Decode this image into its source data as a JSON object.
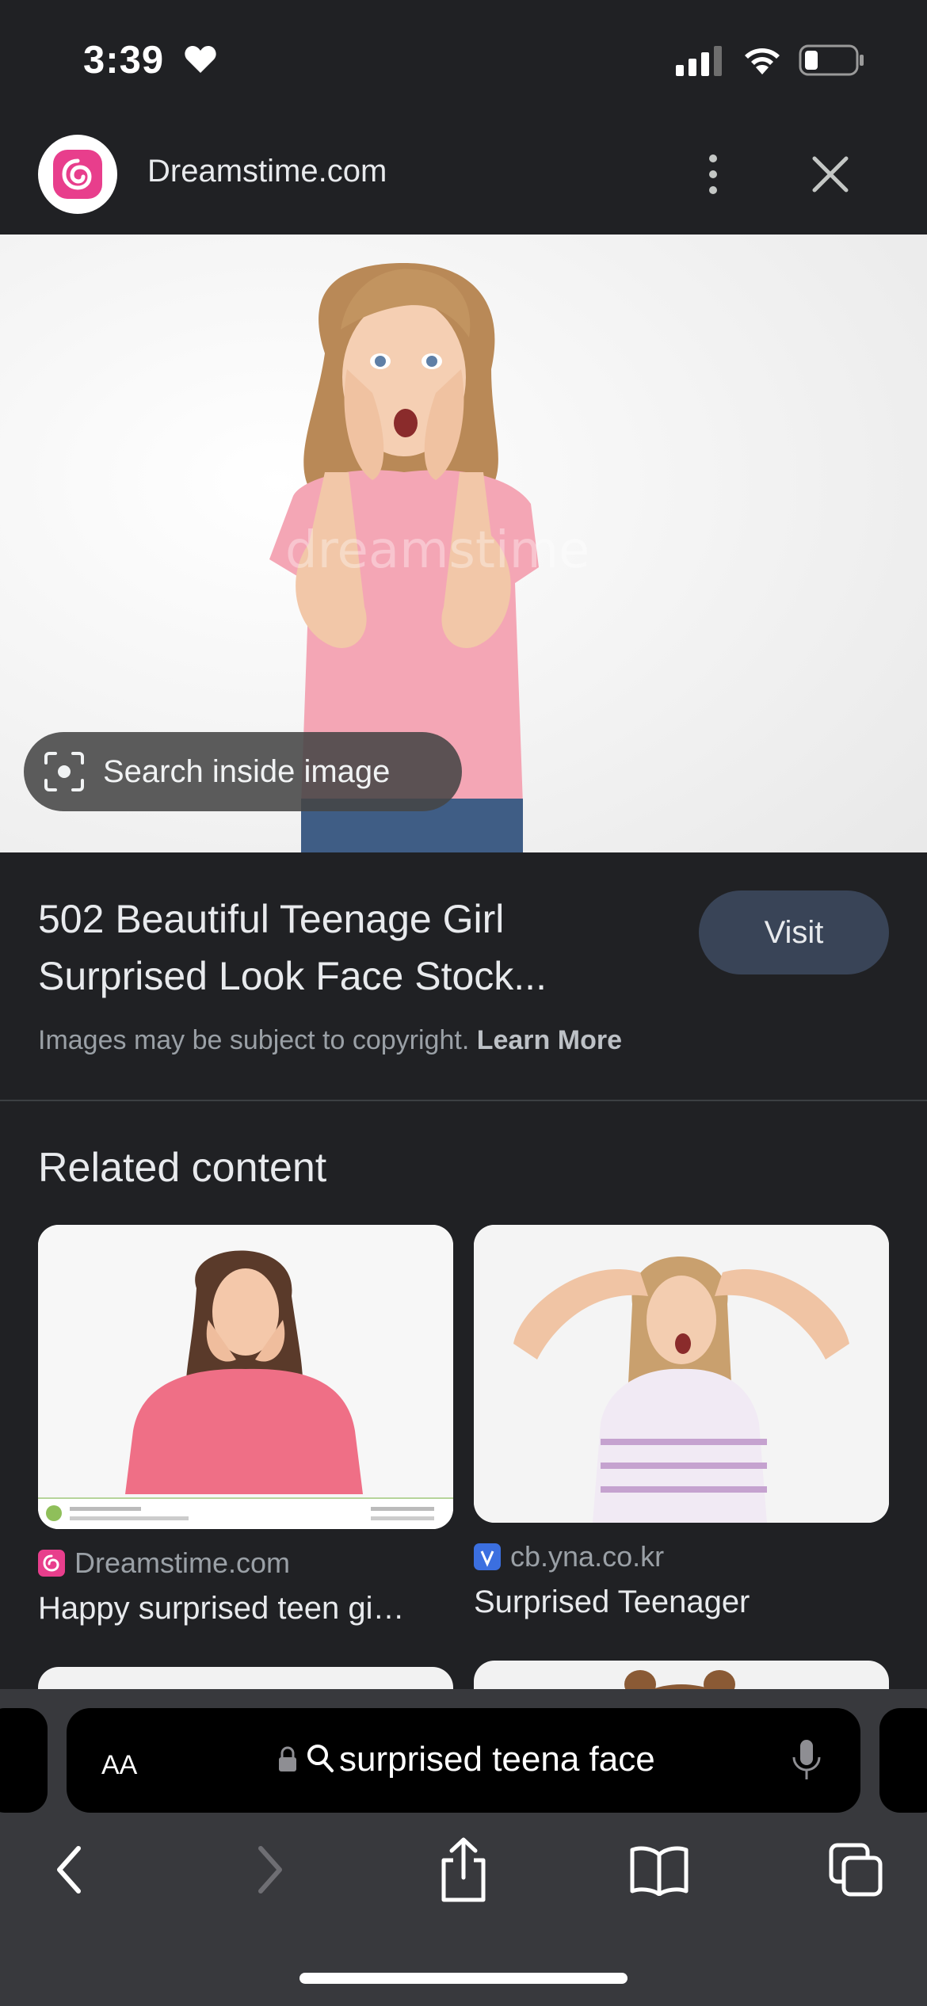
{
  "status_bar": {
    "time": "3:39"
  },
  "header": {
    "site_name": "Dreamstime.com"
  },
  "main_image": {
    "lens_label": "Search inside image"
  },
  "result": {
    "title": "502 Beautiful Teenage Girl Surprised Look Face Stock...",
    "visit_label": "Visit",
    "copyright_text": "Images may be subject to copyright.",
    "learn_more": "Learn More"
  },
  "related": {
    "heading": "Related content",
    "items": [
      {
        "source": "Dreamstime.com",
        "title": "Happy surprised teen gi…"
      },
      {
        "source": "cb.yna.co.kr",
        "title": "Surprised Teenager"
      }
    ]
  },
  "address_bar": {
    "aa_label": "AA",
    "query": "surprised teena face"
  },
  "colors": {
    "background": "#202124",
    "visit_button": "#394457",
    "logo_pink": "#e83e8c"
  },
  "icons": [
    "heart-icon",
    "signal-icon",
    "wifi-icon",
    "battery-icon",
    "more-vert-icon",
    "close-icon",
    "lens-icon",
    "lock-icon",
    "search-icon",
    "mic-icon",
    "back-icon",
    "forward-icon",
    "share-icon",
    "bookmarks-icon",
    "tabs-icon"
  ]
}
